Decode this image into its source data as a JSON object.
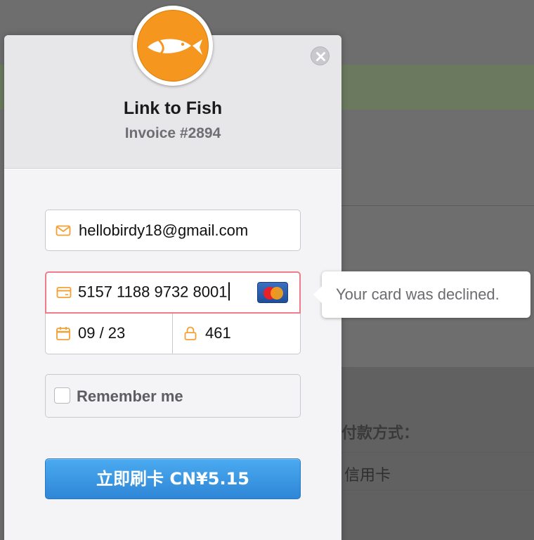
{
  "modal": {
    "title": "Link to Fish",
    "subtitle": "Invoice #2894",
    "email_value": "hellobirdy18@gmail.com",
    "card_number_value": "5157 1188 9732 8001",
    "card_brand_text": "MasterCard",
    "expiry_value": "09 / 23",
    "cvc_value": "461",
    "remember_label": "Remember me",
    "pay_button_label": "立即刷卡 CN¥5.15",
    "error_tooltip": "Your card was declined."
  },
  "background_page": {
    "payment_method_label": "付款方式：",
    "credit_card_option": "信用卡"
  },
  "colors": {
    "logo_orange": "#f5961f",
    "pay_button_blue": "#3a96e4",
    "error_border": "#ef7c88",
    "icon_orange": "#f5a033"
  },
  "icons": [
    "fish-logo-icon",
    "close-icon",
    "envelope-icon",
    "credit-card-icon",
    "mastercard-icon",
    "calendar-icon",
    "lock-icon"
  ]
}
